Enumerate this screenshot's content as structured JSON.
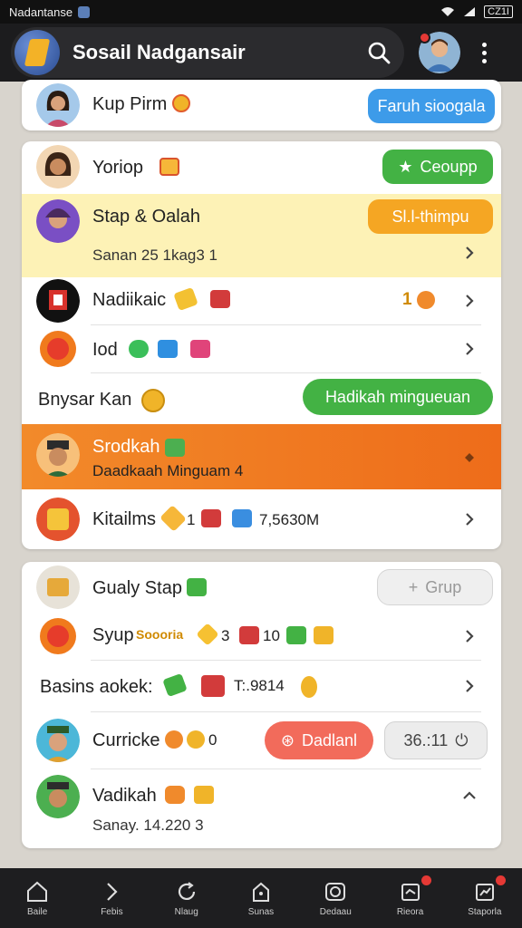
{
  "status_bar": {
    "app_name": "Nadantanse",
    "battery": "CZ1I"
  },
  "app_bar": {
    "title": "Sosail Nadgansair"
  },
  "card1": {
    "row": {
      "label": "Kup Pirm",
      "button": "Faruh sioogala"
    }
  },
  "card2": {
    "row1": {
      "label": "Yoriop",
      "button": "Ceoupp"
    },
    "row2": {
      "label": "Stap & Oalah",
      "sub": "Sanan 25 1kag3  1",
      "button": "Sl.l-thimpu"
    },
    "row3": {
      "label": "Nadiikaic",
      "count": "1"
    },
    "row4": {
      "label": "Iod"
    },
    "row5": {
      "label": "Bnysar Kan",
      "button": "Hadikah mingueuan"
    },
    "row6": {
      "label": "Srodkah",
      "sub": "Daadkaah Minguam  4"
    },
    "row7": {
      "label": "Kitailms",
      "value1": "1",
      "value2": "7,5630M"
    }
  },
  "card3": {
    "row1": {
      "label": "Gualy Stap",
      "button": "Grup"
    },
    "row2": {
      "label": "Syup",
      "tag": "Soooria",
      "value1": "3",
      "value2": "10"
    },
    "row3": {
      "label": "Basins aokek:",
      "value": "T:.9814"
    },
    "row4": {
      "label": "Curricke",
      "count": "0",
      "button": "Dadlanl",
      "timer": "36.:11"
    },
    "row5": {
      "label": "Vadikah",
      "sub": "Sanay. 14.220  3"
    }
  },
  "bottom_nav": [
    {
      "label": "Baile",
      "icon": "home-icon"
    },
    {
      "label": "Febis",
      "icon": "chevron-right-icon"
    },
    {
      "label": "Nlaug",
      "icon": "refresh-icon"
    },
    {
      "label": "Sunas",
      "icon": "house-icon"
    },
    {
      "label": "Dedaau",
      "icon": "camera-icon"
    },
    {
      "label": "Rieora",
      "icon": "trophy-icon"
    },
    {
      "label": "Staporla",
      "icon": "chart-icon"
    }
  ],
  "colors": {
    "blue_button": "#3d9be9",
    "green_button": "#43b244",
    "orange_button": "#f5a623",
    "highlight_yellow": "#fdf2b6",
    "highlight_orange": "#f07a23",
    "red_button": "#f26b5b"
  }
}
